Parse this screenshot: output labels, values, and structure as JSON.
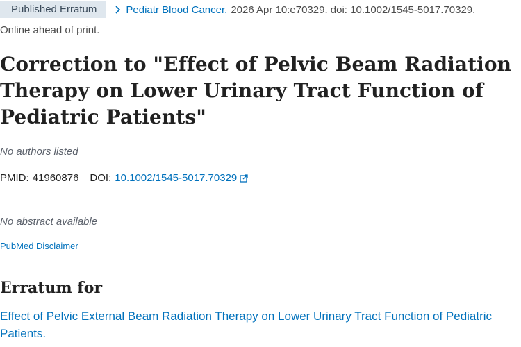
{
  "header": {
    "badge": "Published Erratum",
    "journal": "Pediatr Blood Cancer.",
    "citation_rest": "2026 Apr 10:e70329. doi: 10.1002/1545-5017.70329.",
    "ahead_of_print": "Online ahead of print."
  },
  "article": {
    "title": "Correction to \"Effect of Pelvic Beam Radiation Therapy on Lower Urinary Tract Function of Pediatric Patients\"",
    "authors": "No authors listed",
    "pmid_label": "PMID:",
    "pmid": "41960876",
    "doi_label": "DOI:",
    "doi": "10.1002/1545-5017.70329",
    "abstract": "No abstract available",
    "disclaimer": "PubMed Disclaimer"
  },
  "erratum": {
    "heading": "Erratum for",
    "link": "Effect of Pelvic External Beam Radiation Therapy on Lower Urinary Tract Function of Pediatric Patients."
  },
  "colors": {
    "link": "#0071bc",
    "badge_bg": "#dfe7ee"
  },
  "icons": {
    "chevron": "chevron-right-icon",
    "external": "external-link-icon"
  }
}
